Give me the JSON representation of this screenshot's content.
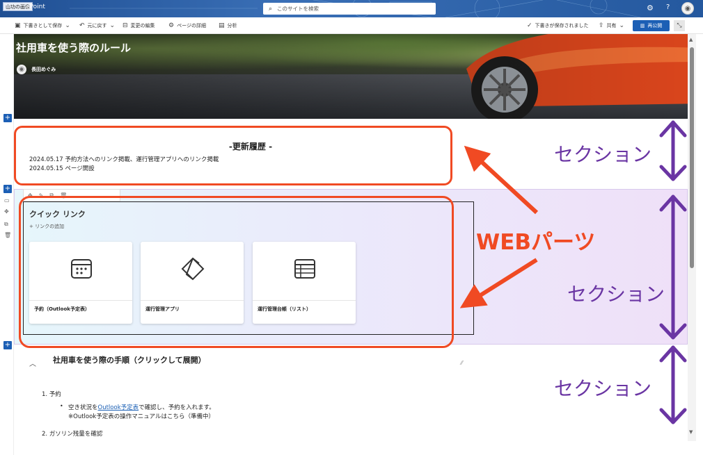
{
  "suitebar": {
    "site_logo": "山功の画像",
    "site_name": "ePoint",
    "search_placeholder": "このサイトを検索",
    "gear_icon": "gear-icon",
    "help_icon": "help-icon"
  },
  "cmdbar": {
    "save_draft": "下書きとして保存",
    "undo": "元に戻す",
    "edit_changes": "変更の編集",
    "page_details": "ページの詳細",
    "analytics": "分析",
    "draft_saved": "下書きが保存されました",
    "share": "共有",
    "republish": "再公開"
  },
  "hero": {
    "title": "社用車を使う際のルール",
    "author": "長田めぐみ"
  },
  "section1": {
    "title": "-更新履歴 -",
    "lines": [
      "2024.05.17 予約方法へのリンク掲載、運行管理アプリへのリンク掲載",
      "2024.05.15 ページ開設"
    ]
  },
  "quicklinks": {
    "title": "クイック リンク",
    "add_link": "+ リンクの追加",
    "cards": [
      {
        "label": "予約（Outlook予定表）",
        "icon": "calendar-icon"
      },
      {
        "label": "運行管理アプリ",
        "icon": "powerapps-icon"
      },
      {
        "label": "運行管理台帳（リスト）",
        "icon": "list-icon"
      }
    ]
  },
  "accordion": {
    "title": "社用車を使う際の手順（クリックして展開）",
    "step1": "1. 予約",
    "bullet1_pre": "空き状況を",
    "bullet1_link": "Outlook予定表",
    "bullet1_post": "で確認し、予約を入れます。",
    "bullet1_sub": "※Outlook予定表の操作マニュアルはこちら（準備中）",
    "step2": "2. ガソリン残量を確認"
  },
  "annotations": {
    "section_label": "セクション",
    "webparts_label": "WEBパーツ",
    "arrow_color": "#f04a23",
    "section_color": "#6a35a3"
  }
}
